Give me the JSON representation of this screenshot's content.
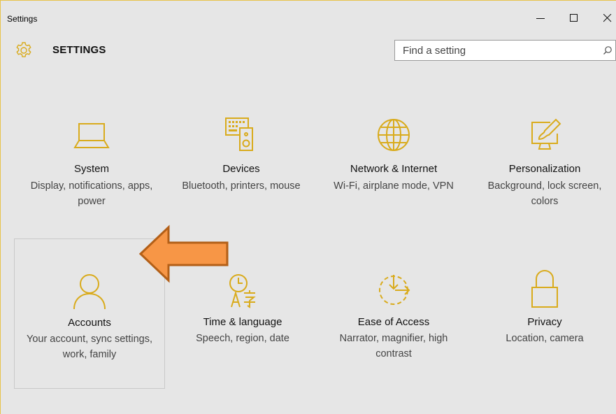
{
  "window": {
    "title": "Settings"
  },
  "header": {
    "title": "SETTINGS",
    "search_placeholder": "Find a setting"
  },
  "colors": {
    "accent": "#d9ab1c",
    "window_bg": "#e6e6e6",
    "arrow_fill": "#f79646",
    "arrow_stroke": "#b35f17"
  },
  "tiles": [
    {
      "name": "System",
      "desc": "Display, notifications, apps, power",
      "icon": "laptop-icon"
    },
    {
      "name": "Devices",
      "desc": "Bluetooth, printers, mouse",
      "icon": "keyboard-speaker-icon"
    },
    {
      "name": "Network & Internet",
      "desc": "Wi-Fi, airplane mode, VPN",
      "icon": "globe-icon"
    },
    {
      "name": "Personalization",
      "desc": "Background, lock screen, colors",
      "icon": "paint-brush-icon"
    },
    {
      "name": "Accounts",
      "desc": "Your account, sync settings, work, family",
      "icon": "person-icon"
    },
    {
      "name": "Time & language",
      "desc": "Speech, region, date",
      "icon": "clock-language-icon"
    },
    {
      "name": "Ease of Access",
      "desc": "Narrator, magnifier, high contrast",
      "icon": "ease-of-access-icon"
    },
    {
      "name": "Privacy",
      "desc": "Location, camera",
      "icon": "lock-icon"
    }
  ],
  "annotation": {
    "arrow_icon": "orange-arrow-left-icon"
  }
}
